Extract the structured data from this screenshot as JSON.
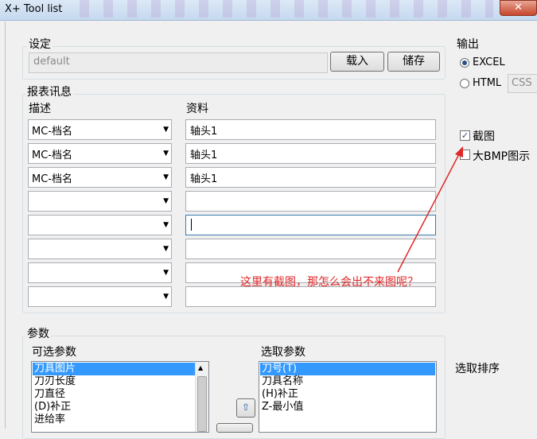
{
  "window": {
    "title": "X+ Tool list",
    "close_glyph": "✕"
  },
  "settings": {
    "label": "设定",
    "value": "default",
    "load_label": "载入",
    "save_label": "储存"
  },
  "output": {
    "label": "输出",
    "excel_label": "EXCEL",
    "html_label": "HTML",
    "css_value": "CSS",
    "screenshot_label": "截图",
    "big_bmp_label": "大BMP图示"
  },
  "report": {
    "label": "报表讯息",
    "desc_header": "描述",
    "data_header": "资料",
    "rows": [
      {
        "desc": "MC-档名",
        "data": "轴头1"
      },
      {
        "desc": "MC-档名",
        "data": "轴头1"
      },
      {
        "desc": "MC-档名",
        "data": "轴头1"
      },
      {
        "desc": "",
        "data": ""
      },
      {
        "desc": "",
        "data": ""
      },
      {
        "desc": "",
        "data": ""
      },
      {
        "desc": "",
        "data": ""
      },
      {
        "desc": "",
        "data": ""
      }
    ]
  },
  "annotation": {
    "text": "这里有截图，那怎么会出不来图呢？",
    "color": "#e02828"
  },
  "params": {
    "label": "参数",
    "available_label": "可选参数",
    "available_items": [
      "刀具图片",
      "刀刃长度",
      "刀直径",
      "(D)补正",
      "进给率"
    ],
    "selected_label": "选取参数",
    "selected_items": [
      "刀号(T)",
      "刀具名称",
      "(H)补正",
      "Z-最小值"
    ],
    "sort_label": "选取排序"
  }
}
